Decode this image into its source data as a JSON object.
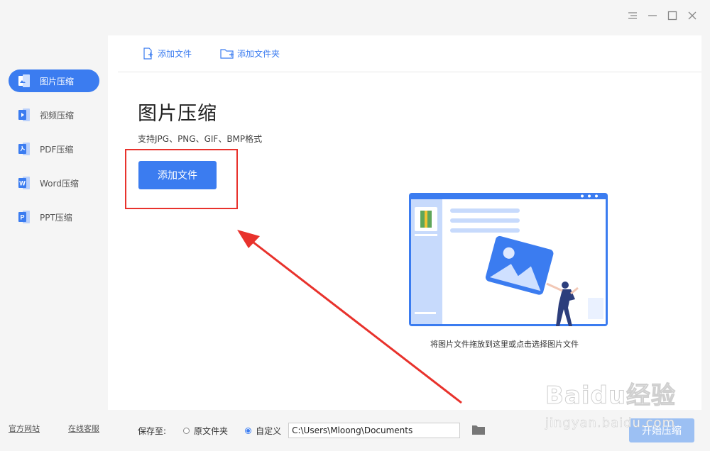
{
  "sidebar": {
    "items": [
      {
        "label": "图片压缩",
        "icon": "image-icon",
        "active": true
      },
      {
        "label": "视频压缩",
        "icon": "video-icon",
        "active": false
      },
      {
        "label": "PDF压缩",
        "icon": "pdf-icon",
        "active": false
      },
      {
        "label": "Word压缩",
        "icon": "word-icon",
        "active": false
      },
      {
        "label": "PPT压缩",
        "icon": "ppt-icon",
        "active": false
      }
    ],
    "footer": {
      "official_site": "官方网站",
      "online_service": "在线客服"
    }
  },
  "toolbar": {
    "add_file": "添加文件",
    "add_folder": "添加文件夹"
  },
  "main": {
    "title": "图片压缩",
    "formats": "支持JPG、PNG、GIF、BMP格式",
    "add_button": "添加文件",
    "drop_hint": "将图片文件拖放到这里或点击选择图片文件"
  },
  "bottom": {
    "save_to_label": "保存至:",
    "option_original": "原文件夹",
    "option_custom": "自定义",
    "selected_option": "自定义",
    "path_value": "C:\\Users\\Mloong\\Documents",
    "start_button": "开始压缩"
  },
  "watermark": {
    "brand": "Baidu经验",
    "url": "jingyan.baidu.com"
  },
  "colors": {
    "accent": "#3b7cf0",
    "annotation": "#e8322c",
    "start_disabled": "#9cc0f3"
  }
}
